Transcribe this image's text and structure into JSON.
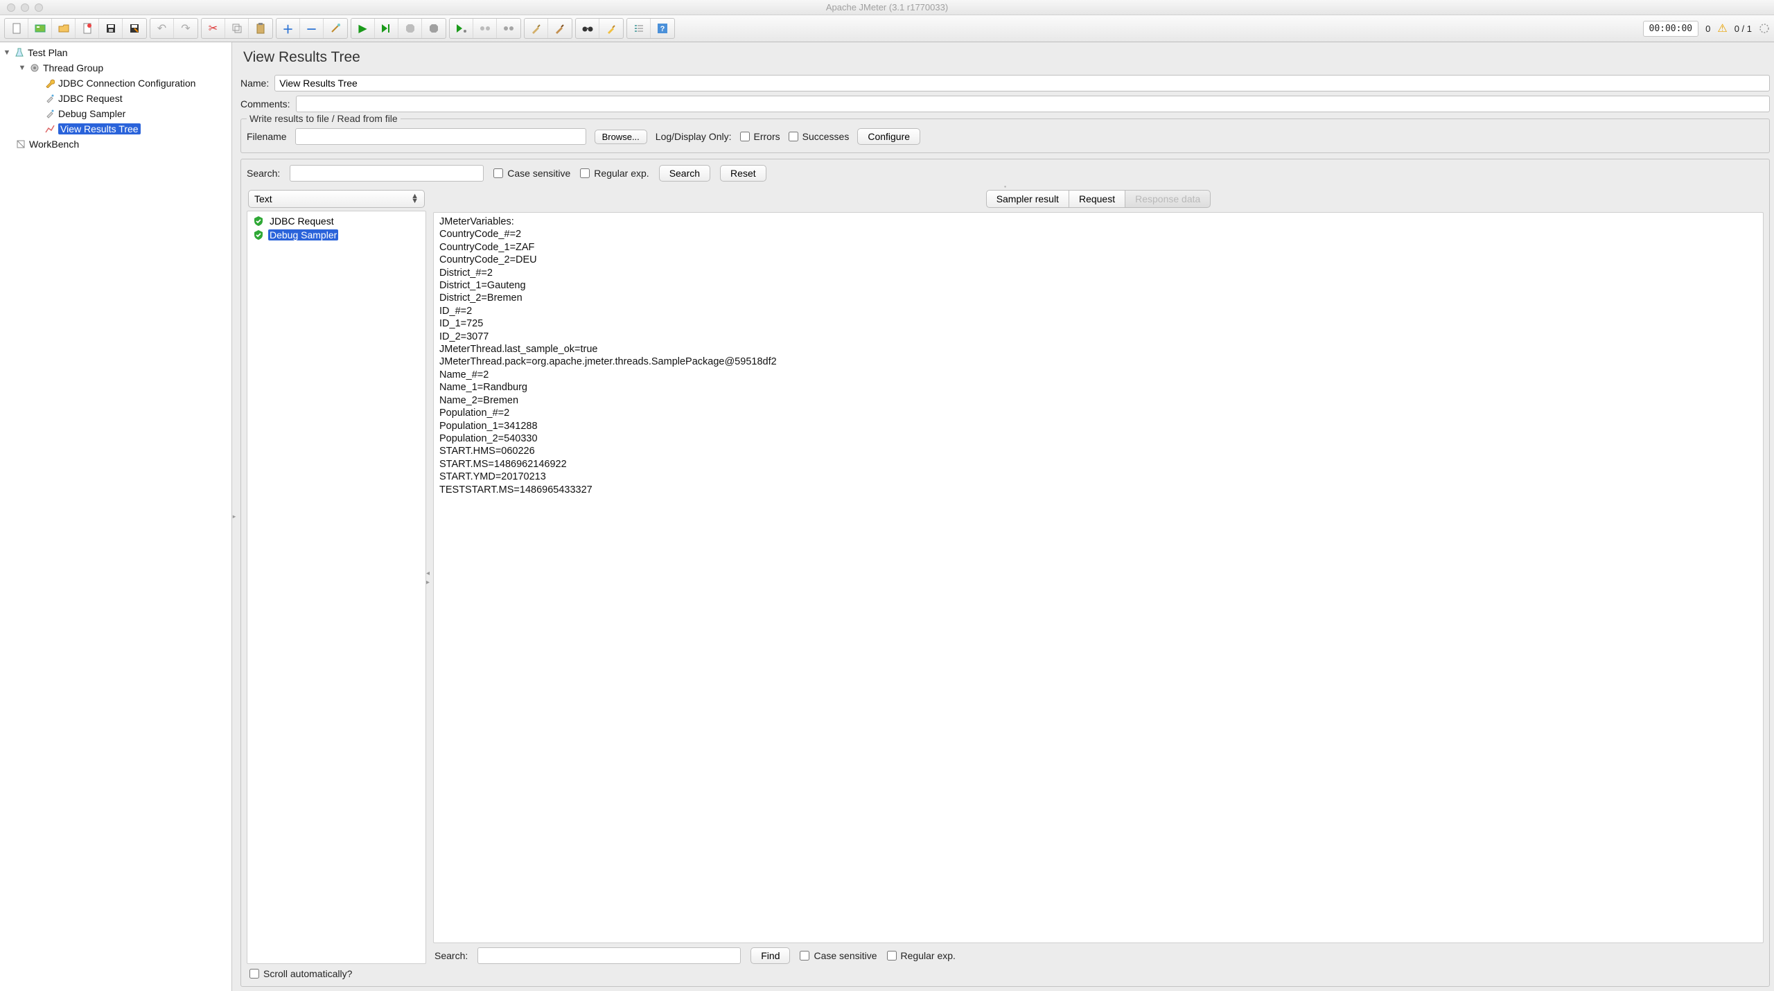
{
  "window": {
    "title": "Apache JMeter (3.1 r1770033)"
  },
  "status": {
    "time": "00:00:00",
    "counter1": "0",
    "counter2": "0 / 1"
  },
  "tree": {
    "testplan": "Test Plan",
    "threadgroup": "Thread Group",
    "jdbc_conn": "JDBC Connection Configuration",
    "jdbc_req": "JDBC Request",
    "debug": "Debug Sampler",
    "view": "View Results Tree",
    "workbench": "WorkBench"
  },
  "panel": {
    "title": "View Results Tree",
    "name_label": "Name:",
    "name_value": "View Results Tree",
    "comments_label": "Comments:",
    "comments_value": ""
  },
  "file": {
    "legend": "Write results to file / Read from file",
    "filename_label": "Filename",
    "filename_value": "",
    "browse": "Browse...",
    "logdisplay": "Log/Display Only:",
    "errors": "Errors",
    "successes": "Successes",
    "configure": "Configure"
  },
  "search": {
    "label": "Search:",
    "value": "",
    "case": "Case sensitive",
    "regex": "Regular exp.",
    "search_btn": "Search",
    "reset_btn": "Reset"
  },
  "renderer": {
    "selected": "Text"
  },
  "results": [
    {
      "name": "JDBC Request",
      "status": "ok"
    },
    {
      "name": "Debug Sampler",
      "status": "ok",
      "selected": true
    }
  ],
  "tabs": {
    "sampler": "Sampler result",
    "request": "Request",
    "response": "Response data"
  },
  "response_text": "JMeterVariables:\nCountryCode_#=2\nCountryCode_1=ZAF\nCountryCode_2=DEU\nDistrict_#=2\nDistrict_1=Gauteng\nDistrict_2=Bremen\nID_#=2\nID_1=725\nID_2=3077\nJMeterThread.last_sample_ok=true\nJMeterThread.pack=org.apache.jmeter.threads.SamplePackage@59518df2\nName_#=2\nName_1=Randburg\nName_2=Bremen\nPopulation_#=2\nPopulation_1=341288\nPopulation_2=540330\nSTART.HMS=060226\nSTART.MS=1486962146922\nSTART.YMD=20170213\nTESTSTART.MS=1486965433327",
  "bottom": {
    "search_label": "Search:",
    "value": "",
    "find": "Find",
    "case": "Case sensitive",
    "regex": "Regular exp."
  },
  "footer": {
    "scroll": "Scroll automatically?"
  }
}
